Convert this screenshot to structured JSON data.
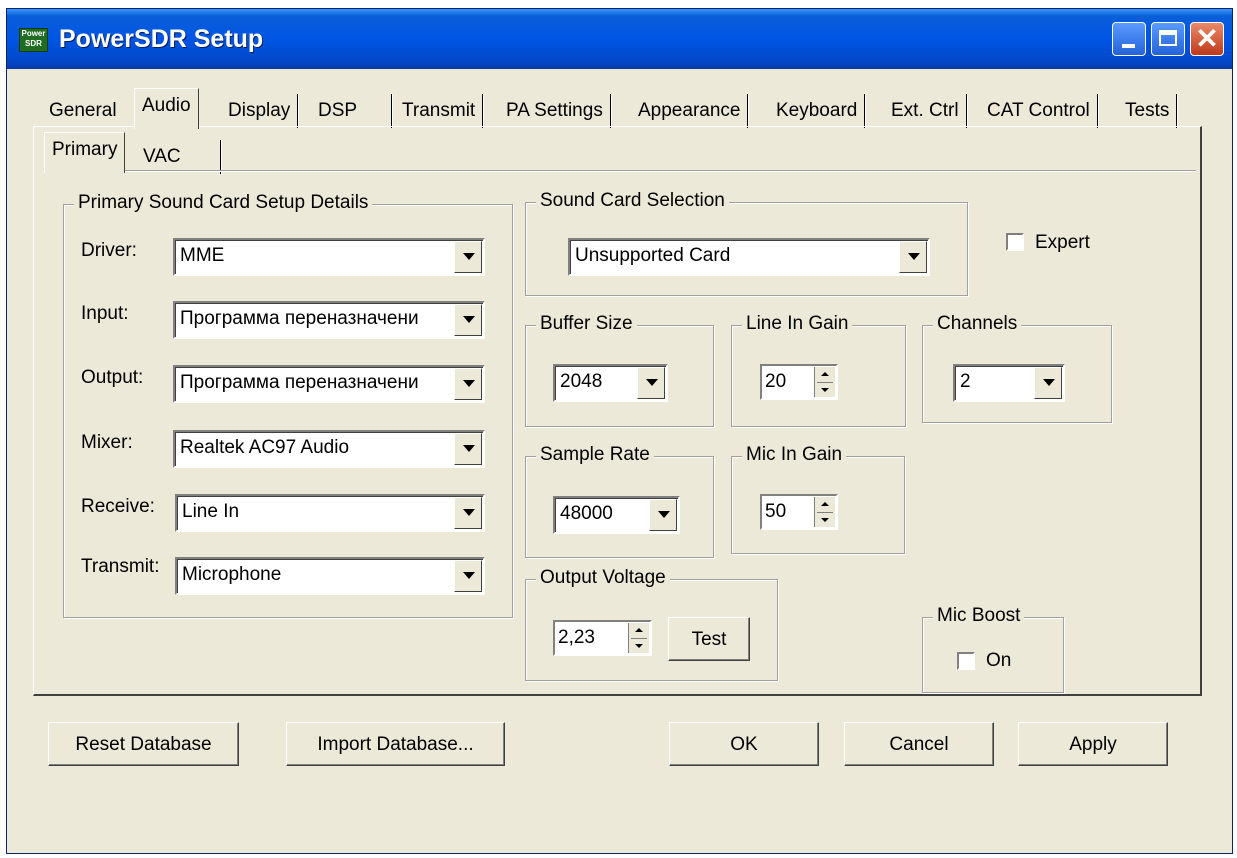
{
  "window": {
    "title": "PowerSDR Setup",
    "icon_label": "Power SDR"
  },
  "tabs": [
    "General",
    "Audio",
    "Display",
    "DSP",
    "Transmit",
    "PA Settings",
    "Appearance",
    "Keyboard",
    "Ext. Ctrl",
    "CAT Control",
    "Tests"
  ],
  "subtabs": [
    "Primary",
    "VAC"
  ],
  "primary_group": {
    "title": "Primary Sound Card Setup Details",
    "driver": {
      "label": "Driver:",
      "value": "MME"
    },
    "input": {
      "label": "Input:",
      "value": "Программа переназначени"
    },
    "output": {
      "label": "Output:",
      "value": "Программа переназначени"
    },
    "mixer": {
      "label": "Mixer:",
      "value": "Realtek AC97 Audio"
    },
    "receive": {
      "label": "Receive:",
      "value": "Line In"
    },
    "transmit": {
      "label": "Transmit:",
      "value": "Microphone"
    }
  },
  "sound_card_selection": {
    "title": "Sound Card Selection",
    "value": "Unsupported Card"
  },
  "expert": {
    "label": "Expert",
    "checked": false
  },
  "buffer_size": {
    "title": "Buffer Size",
    "value": "2048"
  },
  "line_in_gain": {
    "title": "Line In Gain",
    "value": "20"
  },
  "channels": {
    "title": "Channels",
    "value": "2"
  },
  "sample_rate": {
    "title": "Sample Rate",
    "value": "48000"
  },
  "mic_in_gain": {
    "title": "Mic In Gain",
    "value": "50"
  },
  "output_voltage": {
    "title": "Output Voltage",
    "value": "2,23",
    "test_label": "Test"
  },
  "mic_boost": {
    "title": "Mic Boost",
    "label": "On",
    "checked": false
  },
  "buttons": {
    "reset": "Reset Database",
    "import": "Import Database...",
    "ok": "OK",
    "cancel": "Cancel",
    "apply": "Apply"
  }
}
